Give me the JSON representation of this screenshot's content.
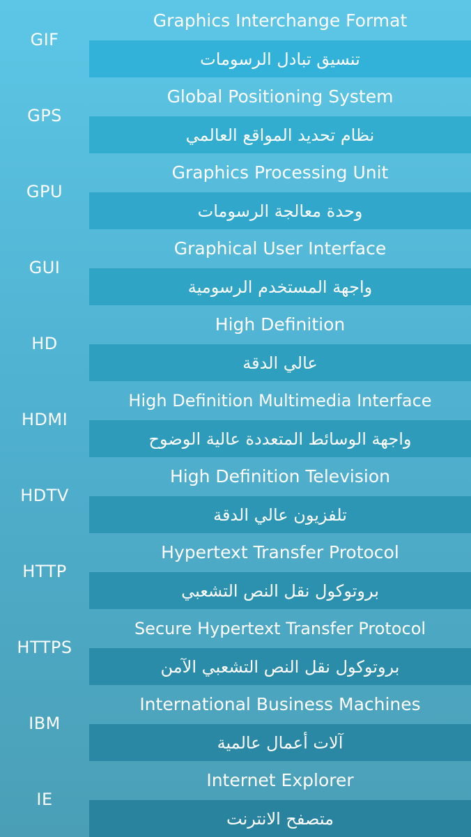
{
  "colors": {
    "background_top": "#5dc6e6",
    "background_bottom": "#4a9fb6",
    "text": "#ffffff"
  },
  "entries": [
    {
      "abbr": "GIF",
      "english": "Graphics Interchange Format",
      "arabic": "تنسيق تبادل الرسومات",
      "band_color": "#33b2d9"
    },
    {
      "abbr": "GPS",
      "english": "Global Positioning System",
      "arabic": "نظام تحديد المواقع العالمي",
      "band_color": "#32adcf"
    },
    {
      "abbr": "GPU",
      "english": "Graphics Processing Unit",
      "arabic": "وحدة معالجة الرسومات",
      "band_color": "#31a8cb"
    },
    {
      "abbr": "GUI",
      "english": "Graphical User Interface",
      "arabic": "واجهة المستخدم الرسومية",
      "band_color": "#30a4c5"
    },
    {
      "abbr": "HD",
      "english": "High Definition",
      "arabic": "عالي الدقة",
      "band_color": "#2f9fc0"
    },
    {
      "abbr": "HDMI",
      "english": "High Definition Multimedia Interface",
      "arabic": "واجهة الوسائط المتعددة عالية الوضوح",
      "band_color": "#2e9bba"
    },
    {
      "abbr": "HDTV",
      "english": "High Definition Television",
      "arabic": "تلفزيون عالي الدقة",
      "band_color": "#2d96b5"
    },
    {
      "abbr": "HTTP",
      "english": "Hypertext Transfer Protocol",
      "arabic": "بروتوكول نقل النص التشعبي",
      "band_color": "#2c91af"
    },
    {
      "abbr": "HTTPS",
      "english": "Secure Hypertext Transfer Protocol",
      "arabic": "بروتوكول نقل النص التشعبي الآمن",
      "band_color": "#2b8ca9"
    },
    {
      "abbr": "IBM",
      "english": "International Business Machines",
      "arabic": "آلات أعمال عالمية",
      "band_color": "#2a88a4"
    },
    {
      "abbr": "IE",
      "english": "Internet Explorer",
      "arabic": "متصفح الانترنت",
      "band_color": "#29839e"
    }
  ]
}
